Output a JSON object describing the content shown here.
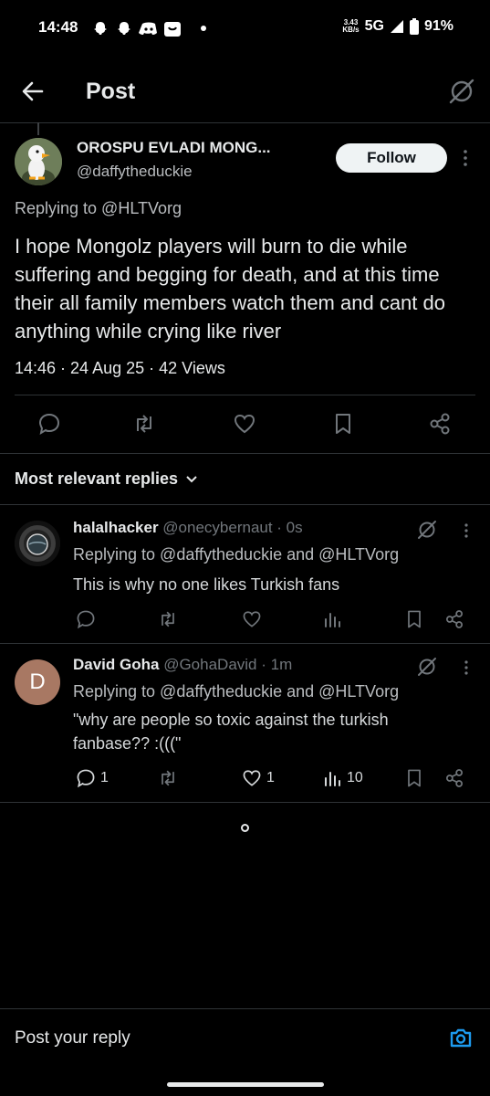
{
  "status_bar": {
    "time": "14:48",
    "speed_value": "3.43",
    "speed_unit": "KB/s",
    "network": "5G",
    "battery": "91%"
  },
  "header": {
    "title": "Post"
  },
  "post": {
    "author_name": "OROSPU EVLADI MONG...",
    "author_handle": "@daffytheduckie",
    "follow_label": "Follow",
    "replying_to": "Replying to @HLTVorg",
    "text": "I hope Mongolz players will burn to die while suffering and begging for death, and at this time their all family members watch them and cant do anything while crying like river",
    "meta": "14:46 · 24 Aug 25 · 42 Views"
  },
  "replies_section": {
    "title": "Most relevant replies"
  },
  "replies": [
    {
      "name": "halalhacker",
      "handle_time": "@onecybernaut · 0s",
      "replying_to": "Replying to @daffytheduckie and @HLTVorg",
      "text": "This is why no one likes Turkish fans",
      "reply_count": "",
      "like_count": "",
      "view_count": ""
    },
    {
      "name": "David Goha",
      "handle_time": "@GohaDavid · 1m",
      "avatar_letter": "D",
      "replying_to": "Replying to @daffytheduckie and @HLTVorg",
      "text": "\"why are people so toxic against the turkish fanbase?? :(((\"",
      "reply_count": "1",
      "like_count": "1",
      "view_count": "10"
    }
  ],
  "composer": {
    "placeholder": "Post your reply"
  },
  "colors": {
    "background": "#000000",
    "text": "#e7e9ea",
    "muted": "#71767b",
    "accent": "#1d9bf0",
    "avatar_d": "#a87863"
  }
}
